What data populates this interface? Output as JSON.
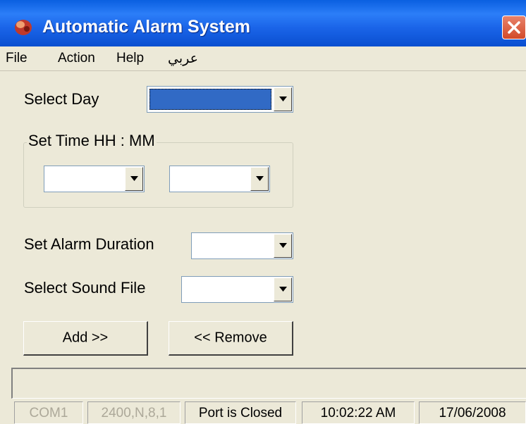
{
  "window": {
    "title": "Automatic Alarm System"
  },
  "menu": {
    "items": [
      "File",
      "Action",
      "Help",
      "عربي"
    ]
  },
  "form": {
    "select_day_label": "Select Day",
    "set_time_label": "Set Time  HH : MM",
    "alarm_duration_label": "Set Alarm Duration",
    "sound_file_label": "Select Sound File"
  },
  "buttons": {
    "add": "Add >>",
    "remove": "<< Remove"
  },
  "status": {
    "port": "COM1",
    "settings": "2400,N,8,1",
    "port_state": "Port is Closed",
    "time": "10:02:22 AM",
    "date": "17/06/2008"
  }
}
